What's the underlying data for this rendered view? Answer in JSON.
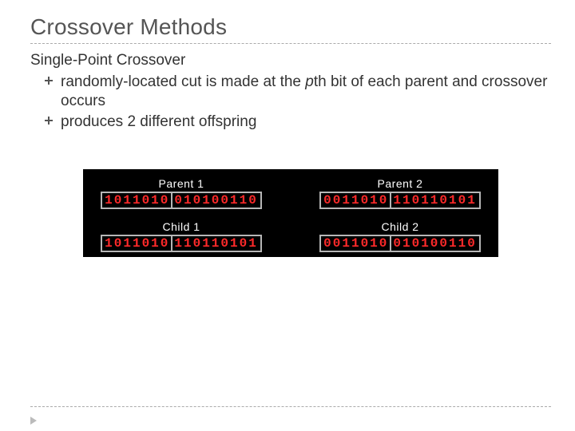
{
  "title": "Crossover Methods",
  "subhead": "Single-Point Crossover",
  "bullets": [
    {
      "pre": "randomly-located cut is made at the ",
      "em": "p",
      "post": "th bit of each parent and crossover occurs"
    },
    {
      "pre": "produces 2 different offspring",
      "em": "",
      "post": ""
    }
  ],
  "diagram": {
    "parent1": {
      "label": "Parent 1",
      "left": "1011010",
      "right": "010100110"
    },
    "parent2": {
      "label": "Parent 2",
      "left": "0011010",
      "right": "110110101"
    },
    "child1": {
      "label": "Child 1",
      "left": "1011010",
      "right": "110110101"
    },
    "child2": {
      "label": "Child 2",
      "left": "0011010",
      "right": "010100110"
    }
  }
}
